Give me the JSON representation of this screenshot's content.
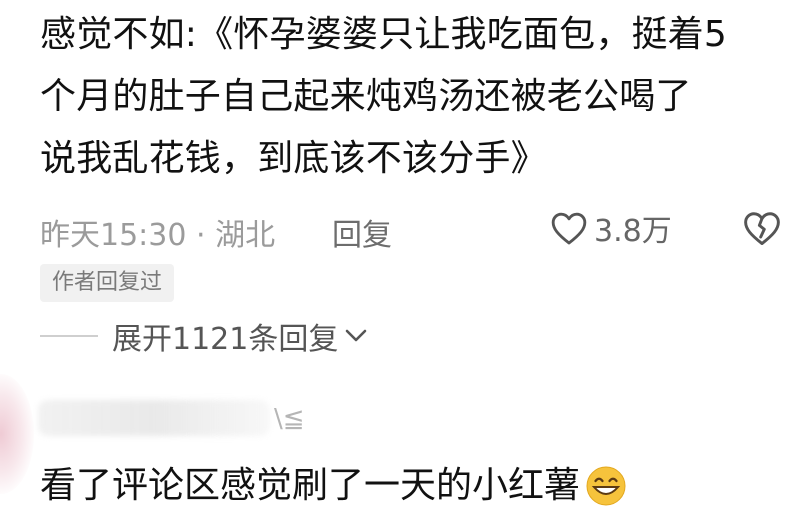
{
  "comment": {
    "line1": "感觉不如:《怀孕婆婆只让我吃面包，挺着5",
    "line2": "个月的肚子自己起来炖鸡汤还被老公喝了",
    "line3": "说我乱花钱，到底该不该分手》"
  },
  "meta": {
    "time_location": "昨天15:30 · 湖北",
    "reply_label": "回复",
    "like_count": "3.8万"
  },
  "author_badge": "作者回复过",
  "expand_label": "展开1121条回复",
  "reply": {
    "name_tail": "\\≦",
    "text": "看了评论区感觉刷了一天的小红薯"
  },
  "icons": {
    "like": "heart-outline-icon",
    "dislike": "broken-heart-icon",
    "expand": "chevron-down-icon",
    "emoji": "grinning-smile-emoji-icon"
  },
  "colors": {
    "text": "#111111",
    "meta": "#9b9b9b",
    "badge_bg": "#f1f1f1",
    "emoji": "#f6c33c"
  }
}
